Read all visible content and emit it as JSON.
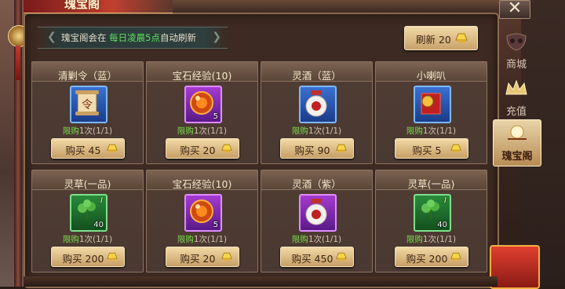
{
  "window": {
    "title": "瑰宝阁",
    "close_glyph": "✕"
  },
  "notice": {
    "prefix": "瑰宝阁会在",
    "highlight": "每日凌晨5点",
    "suffix": "自动刷新"
  },
  "refresh": {
    "label": "刷新 20",
    "cost_icon": "gold-ingot-icon"
  },
  "side_tabs": [
    {
      "label": "商城",
      "icon": "mall-mask-icon",
      "active": false
    },
    {
      "label": "充值",
      "icon": "crown-icon",
      "active": false
    },
    {
      "label": "瑰宝阁",
      "icon": "treasure-pavilion-icon",
      "active": true
    }
  ],
  "items": [
    {
      "name": "清剿令（蓝）",
      "frame": "blue",
      "icon": "scroll-order-icon",
      "qty": "",
      "grade": "",
      "limit": "限购",
      "limit_count": "1次(1/1)",
      "price": "购买 45"
    },
    {
      "name": "宝石经验(10)",
      "frame": "purple",
      "icon": "gem-exp-icon",
      "qty": "5",
      "grade": "",
      "limit": "限购",
      "limit_count": "1次(1/1)",
      "price": "购买 20"
    },
    {
      "name": "灵酒（蓝）",
      "frame": "blue",
      "icon": "wine-jar-icon",
      "qty": "",
      "grade": "",
      "limit": "限购",
      "limit_count": "1次(1/1)",
      "price": "购买 90"
    },
    {
      "name": "小喇叭",
      "frame": "blue",
      "icon": "trumpet-icon",
      "qty": "",
      "grade": "",
      "limit": "限购",
      "limit_count": "1次(1/1)",
      "price": "购买 5"
    },
    {
      "name": "灵草(一品)",
      "frame": "green",
      "icon": "herb-icon",
      "qty": "40",
      "grade": "I",
      "limit": "限购",
      "limit_count": "1次(1/1)",
      "price": "购买 200"
    },
    {
      "name": "宝石经验(10)",
      "frame": "purple",
      "icon": "gem-exp-icon",
      "qty": "5",
      "grade": "",
      "limit": "限购",
      "limit_count": "1次(1/1)",
      "price": "购买 20"
    },
    {
      "name": "灵酒（紫）",
      "frame": "purple",
      "icon": "wine-jar-icon",
      "qty": "",
      "grade": "",
      "limit": "限购",
      "limit_count": "1次(1/1)",
      "price": "购买 450"
    },
    {
      "name": "灵草(一品)",
      "frame": "green",
      "icon": "herb-icon",
      "qty": "40",
      "grade": "I",
      "limit": "限购",
      "limit_count": "1次(1/1)",
      "price": "购买 200"
    }
  ],
  "colors": {
    "limit_green": "#7cdc4a",
    "notice_highlight": "#5fe05f",
    "button_gold": "#e9cf98"
  }
}
